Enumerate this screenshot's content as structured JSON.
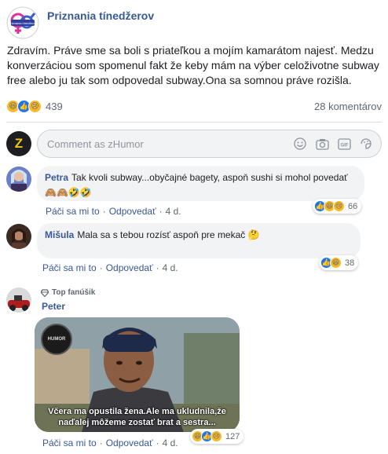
{
  "post": {
    "page_name": "Priznania tínedžerov",
    "logo_text": "Priznania tínedžerov",
    "text": "Zdravím. Práve sme sa boli s priateľkou a mojím kamarátom najesť. Medzu konverzáciou som spomenul fakt že keby mám na výber celoživotne subway free alebo ju tak som odpovedal subway.Ona sa somnou práve rozišla.",
    "reaction_count": "439",
    "comment_count": "28 komentárov",
    "reactions": [
      "haha",
      "like",
      "sad"
    ]
  },
  "composer": {
    "placeholder": "Comment as zHumor",
    "icons": [
      "emoji-icon",
      "camera-icon",
      "gif-icon",
      "sticker-icon"
    ]
  },
  "comments": [
    {
      "author": "Petra",
      "text": "Tak kvoli subway...obyčajné bagety, aspoň sushi si mohol povedať 🙈🙈🤣🤣",
      "reaction_count": "66",
      "like_label": "Páči sa mi to",
      "reply_label": "Odpovedať",
      "time": "4 d."
    },
    {
      "author": "Mišula",
      "text": "Mala sa s tebou rozísť aspoň pre mekač 🤔",
      "reaction_count": "38",
      "like_label": "Páči sa mi to",
      "reply_label": "Odpovedať",
      "time": "4 d."
    },
    {
      "author": "Peter",
      "badge": "Top fanúšik",
      "gif_caption_line1": "Včera ma opustila žena.Ale ma ukludnila,že",
      "gif_caption_line2": "naďalej môžeme zostať brat a sestra...",
      "reaction_count": "127",
      "like_label": "Páči sa mi to",
      "reply_label": "Odpovedať",
      "time": "4 d."
    }
  ],
  "colors": {
    "link_blue": "#385898",
    "bubble_bg": "#f2f3f5",
    "like_blue": "#1877f2",
    "haha_yellow": "#f7b928"
  }
}
